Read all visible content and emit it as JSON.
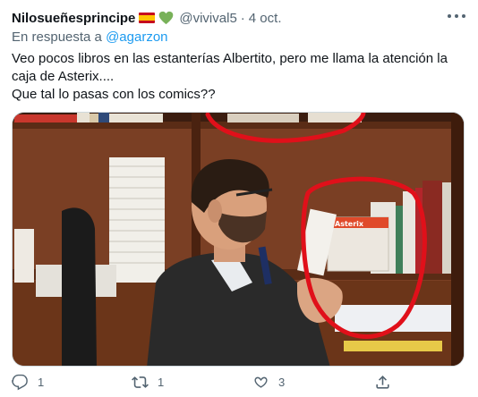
{
  "tweet": {
    "author": {
      "name": "Nilosueñesprincipe",
      "flag_icon": "spain-flag-icon",
      "heart_icon": "green-heart-icon",
      "handle": "@vivival5",
      "separator": "·",
      "date": "4 oct."
    },
    "reply": {
      "prefix": "En respuesta a",
      "mention": "@agarzon"
    },
    "text_lines": [
      "Veo pocos libros en las estanterías Albertito, pero me llama la atención la caja de Asterix....",
      "Que tal lo pasas con los comics??"
    ],
    "photo": {
      "box_label": "Asterix"
    },
    "actions": {
      "reply_count": "1",
      "retweet_count": "1",
      "like_count": "3",
      "share_icon": "share-icon"
    }
  },
  "colors": {
    "text": "#0f1419",
    "secondary": "#536471",
    "link": "#1d9bf0",
    "heart": "#78b159",
    "annotation_red": "#e0101a"
  }
}
